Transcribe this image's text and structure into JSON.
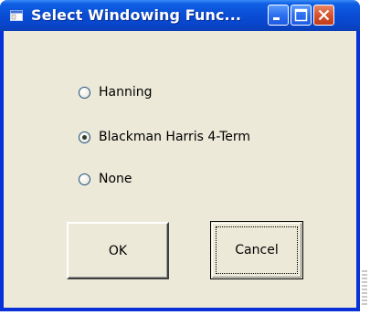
{
  "window": {
    "title": "Select Windowing Func...",
    "controls": {
      "minimize": "minimize-icon",
      "maximize": "maximize-icon",
      "close": "close-icon"
    }
  },
  "options": [
    {
      "label": "Hanning",
      "checked": false
    },
    {
      "label": "Blackman Harris 4-Term",
      "checked": true
    },
    {
      "label": "None",
      "checked": false
    }
  ],
  "buttons": {
    "ok_label": "OK",
    "cancel_label": "Cancel"
  },
  "colors": {
    "titlebar": "#0a4fd6",
    "frame": "#0831d9",
    "client": "#ece9d8",
    "close_button": "#d6532e"
  }
}
